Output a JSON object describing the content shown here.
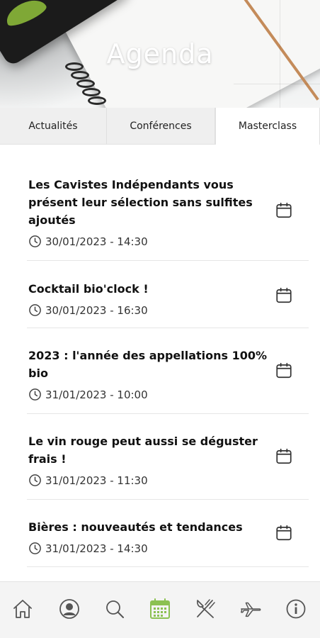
{
  "header": {
    "title": "Agenda"
  },
  "tabs": [
    {
      "label": "Actualités",
      "active": false
    },
    {
      "label": "Conférences",
      "active": false
    },
    {
      "label": "Masterclass",
      "active": true
    }
  ],
  "events": [
    {
      "title": "Les Cavistes Indépendants vous présent leur sélection sans sulfites ajoutés",
      "datetime": "30/01/2023 - 14:30"
    },
    {
      "title": "Cocktail bio'clock !",
      "datetime": "30/01/2023 - 16:30"
    },
    {
      "title": "2023 : l'année des appellations 100% bio",
      "datetime": "31/01/2023 - 10:00"
    },
    {
      "title": "Le vin rouge peut aussi se déguster frais !",
      "datetime": "31/01/2023 - 11:30"
    },
    {
      "title": "Bières : nouveautés et tendances",
      "datetime": "31/01/2023 - 14:30"
    }
  ],
  "nav": {
    "items": [
      "home-icon",
      "profile-icon",
      "search-icon",
      "calendar-icon",
      "food-icon",
      "plane-icon",
      "info-icon"
    ],
    "active": "calendar-icon"
  },
  "colors": {
    "accent": "#8cc152",
    "icon": "#555555"
  }
}
